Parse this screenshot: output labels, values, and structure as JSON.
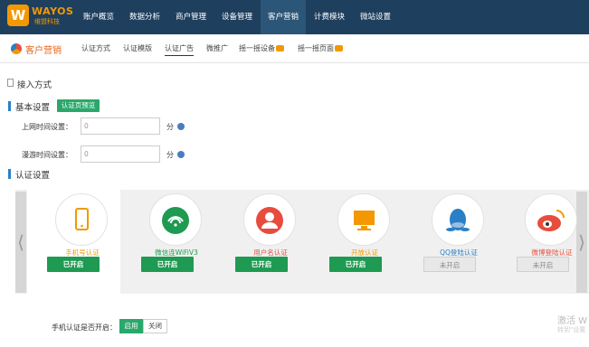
{
  "logo": {
    "mark": "W",
    "title": "WAYOS",
    "subtitle": "维盟科技"
  },
  "nav": [
    "账户概览",
    "数据分析",
    "商户管理",
    "设备管理",
    "客户营销",
    "计费模块",
    "微站设置"
  ],
  "subheader": {
    "title": "客户营销",
    "tabs": [
      "认证方式",
      "认证模版",
      "认证广告",
      "微推广",
      "摇一摇设备",
      "摇一摇页面"
    ]
  },
  "section_title": "接入方式",
  "basic": {
    "heading": "基本设置",
    "preview_button": "认证页预览",
    "fields": [
      {
        "label": "上网时间设置：",
        "value": "0",
        "unit": "分"
      },
      {
        "label": "漫游时间设置：",
        "value": "0",
        "unit": "分"
      }
    ]
  },
  "auth": {
    "heading": "认证设置",
    "methods": [
      {
        "label": "手机号认证",
        "status": "已开启",
        "enabled": true,
        "icon": "mobile-phone-icon",
        "color": "#f39800"
      },
      {
        "label": "微信连WiFiV3",
        "status": "已开启",
        "enabled": true,
        "icon": "wechat-wifi-icon",
        "color": "#1f9a52"
      },
      {
        "label": "用户名认证",
        "status": "已开启",
        "enabled": true,
        "icon": "user-icon",
        "color": "#e84c3d"
      },
      {
        "label": "开放认证",
        "status": "已开启",
        "enabled": true,
        "icon": "monitor-icon",
        "color": "#f39800"
      },
      {
        "label": "QQ登陆认证",
        "status": "未开启",
        "enabled": false,
        "icon": "qq-icon",
        "color": "#2a7fc6"
      },
      {
        "label": "微博登陆认证",
        "status": "未开启",
        "enabled": false,
        "icon": "weibo-icon",
        "color": "#e84c3d"
      }
    ]
  },
  "toggle": {
    "label": "手机认证是否开启：",
    "on": "启用",
    "off": "关闭"
  },
  "watermark": {
    "line1": "激活 W",
    "line2": "转到\"设置"
  },
  "colors": {
    "nav_bg": "#1f3f5e",
    "accent": "#f39800",
    "green": "#2aa86b"
  }
}
